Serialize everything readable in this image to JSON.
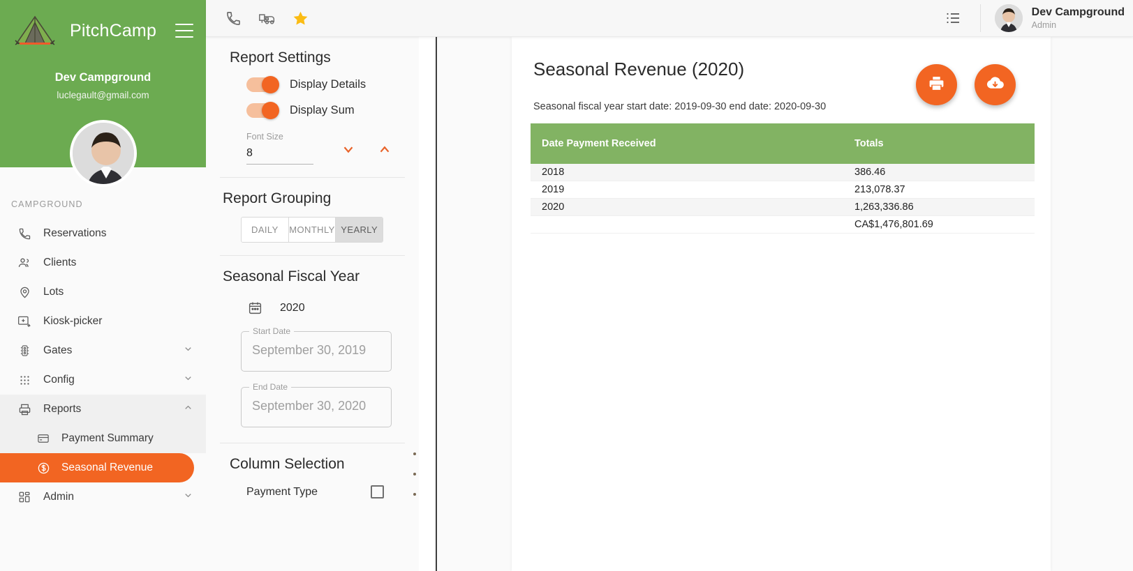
{
  "brand": {
    "name": "PitchCamp",
    "logo_icon": "tent-icon",
    "menu_icon": "hamburger-menu-icon"
  },
  "sidebar": {
    "org_name": "Dev Campground",
    "email": "luclegault@gmail.com",
    "avatar_icon": "user-avatar",
    "section_label": "CAMPGROUND",
    "items": [
      {
        "label": "Reservations",
        "icon": "phone-icon",
        "chevron": ""
      },
      {
        "label": "Clients",
        "icon": "people-icon",
        "chevron": ""
      },
      {
        "label": "Lots",
        "icon": "map-pin-icon",
        "chevron": ""
      },
      {
        "label": "Kiosk-picker",
        "icon": "kiosk-icon",
        "chevron": ""
      },
      {
        "label": "Gates",
        "icon": "traffic-light-icon",
        "chevron": "chevron-down-icon"
      },
      {
        "label": "Config",
        "icon": "grid-dots-icon",
        "chevron": "chevron-down-icon"
      },
      {
        "label": "Reports",
        "icon": "printer-icon",
        "chevron": "chevron-up-icon"
      },
      {
        "label": "Admin",
        "icon": "dashboard-icon",
        "chevron": "chevron-down-icon"
      }
    ],
    "reports_children": [
      {
        "label": "Payment Summary",
        "icon": "credit-card-icon",
        "active": false
      },
      {
        "label": "Seasonal Revenue",
        "icon": "dollar-circle-icon",
        "active": true
      }
    ]
  },
  "topbar": {
    "icons": [
      {
        "name": "phone-icon"
      },
      {
        "name": "rv-camper-icon"
      },
      {
        "name": "star-icon",
        "color": "#fbbc14"
      }
    ],
    "list_icon": "list-icon",
    "user_name": "Dev Campground",
    "user_role": "Admin",
    "avatar_icon": "user-avatar"
  },
  "settings": {
    "report_settings_title": "Report Settings",
    "display_details_label": "Display Details",
    "display_details_on": true,
    "display_sum_label": "Display Sum",
    "display_sum_on": true,
    "font_size_label": "Font Size",
    "font_size_value": "8",
    "font_size_down_icon": "chevron-down-icon",
    "font_size_up_icon": "chevron-up-icon",
    "report_grouping_title": "Report Grouping",
    "grouping_options": [
      "DAILY",
      "MONTHLY",
      "YEARLY"
    ],
    "grouping_selected": "YEARLY",
    "fiscal_year_title": "Seasonal Fiscal Year",
    "fiscal_year_value": "2020",
    "calendar_icon": "calendar-icon",
    "start_date_label": "Start Date",
    "start_date_value": "September 30, 2019",
    "end_date_label": "End Date",
    "end_date_value": "September 30, 2020",
    "column_selection_title": "Column Selection",
    "payment_type_label": "Payment Type",
    "payment_type_checked": false,
    "drag_handle_icon": "drag-handle-icon"
  },
  "report": {
    "title": "Seasonal Revenue (2020)",
    "subtitle": "Seasonal fiscal year start date: 2019-09-30 end date: 2020-09-30",
    "print_icon": "printer-icon",
    "download_icon": "cloud-download-icon",
    "columns": [
      "Date Payment Received",
      "Totals"
    ],
    "rows": [
      {
        "date": "2018",
        "total": "386.46"
      },
      {
        "date": "2019",
        "total": "213,078.37"
      },
      {
        "date": "2020",
        "total": "1,263,336.86"
      }
    ],
    "grand_total_label": "",
    "grand_total": "CA$1,476,801.69"
  },
  "colors": {
    "brand_green": "#6cab51",
    "table_header_green": "#82b363",
    "accent_orange": "#f26522",
    "star_yellow": "#fbbc14"
  }
}
